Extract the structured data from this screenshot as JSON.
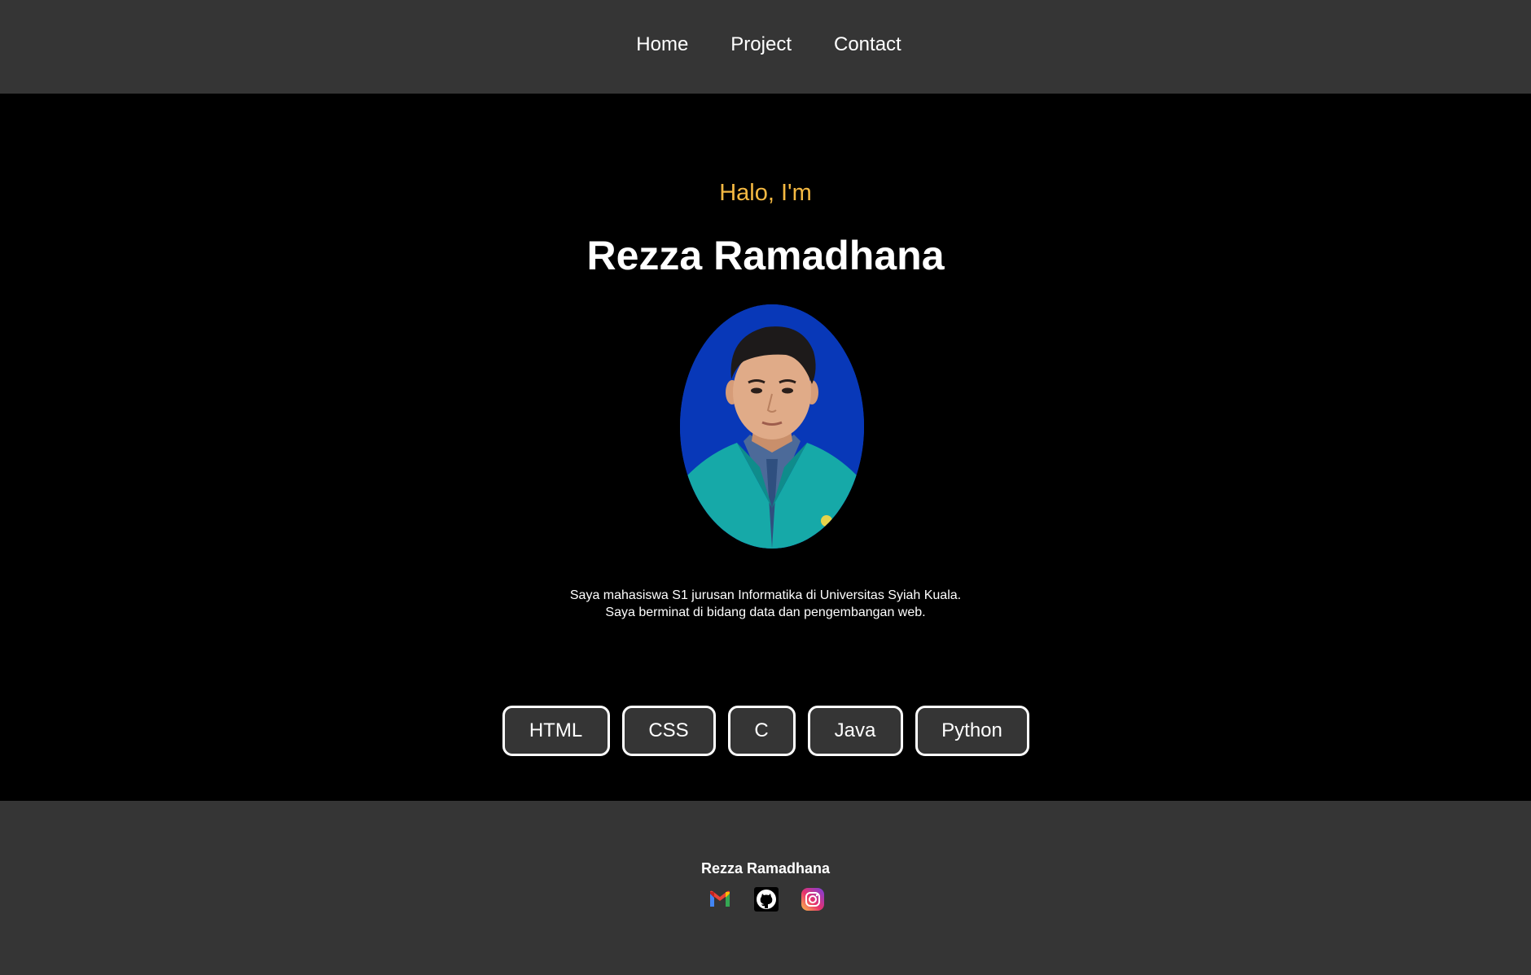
{
  "nav": {
    "items": [
      {
        "label": "Home"
      },
      {
        "label": "Project"
      },
      {
        "label": "Contact"
      }
    ]
  },
  "hero": {
    "greeting": "Halo, I'm",
    "name": "Rezza Ramadhana",
    "bio_lines": [
      "Saya mahasiswa S1 jurusan Informatika di Universitas Syiah Kuala.",
      "Saya berminat di bidang data dan pengembangan web."
    ],
    "skills": [
      "HTML",
      "CSS",
      "C",
      "Java",
      "Python"
    ]
  },
  "footer": {
    "name": "Rezza Ramadhana",
    "socials": [
      {
        "icon": "gmail-icon"
      },
      {
        "icon": "github-icon"
      },
      {
        "icon": "instagram-icon"
      }
    ]
  },
  "colors": {
    "greeting": "#f5b942",
    "bar_bg": "#353535",
    "page_bg": "#000000",
    "text": "#ffffff",
    "portrait_bg": "#0838b8"
  }
}
